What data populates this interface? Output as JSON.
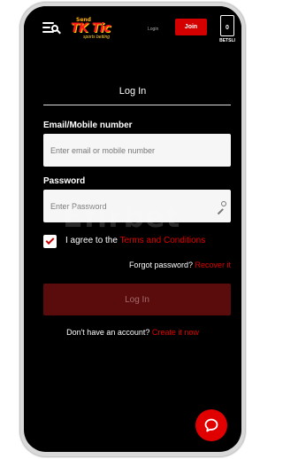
{
  "header": {
    "logo": {
      "line1": "Send",
      "line2": "TK Tic",
      "line3": "sports betting"
    },
    "login_label": "Login",
    "join_label": "Join",
    "betslip": {
      "count": "0",
      "label": "BETSLI"
    }
  },
  "form": {
    "title": "Log In",
    "email": {
      "label": "Email/Mobile number",
      "placeholder": "Enter email or mobile number"
    },
    "password": {
      "label": "Password",
      "placeholder": "Enter Password"
    },
    "terms": {
      "prefix": "I agree to the ",
      "link": "Terms and Conditions",
      "checked": true
    },
    "forgot": {
      "prefix": "Forgot password? ",
      "link": "Recover it"
    },
    "submit_label": "Log In",
    "signup": {
      "prefix": "Don't have an account? ",
      "link": "Create it now"
    }
  },
  "watermark": "Efirbet",
  "icons": [
    "menu-search-icon",
    "key-icon",
    "check-icon",
    "chat-icon"
  ],
  "colors": {
    "accent": "#e00000",
    "join": "#d40000",
    "submit_disabled": "#5a0b0b",
    "background": "#000000"
  }
}
